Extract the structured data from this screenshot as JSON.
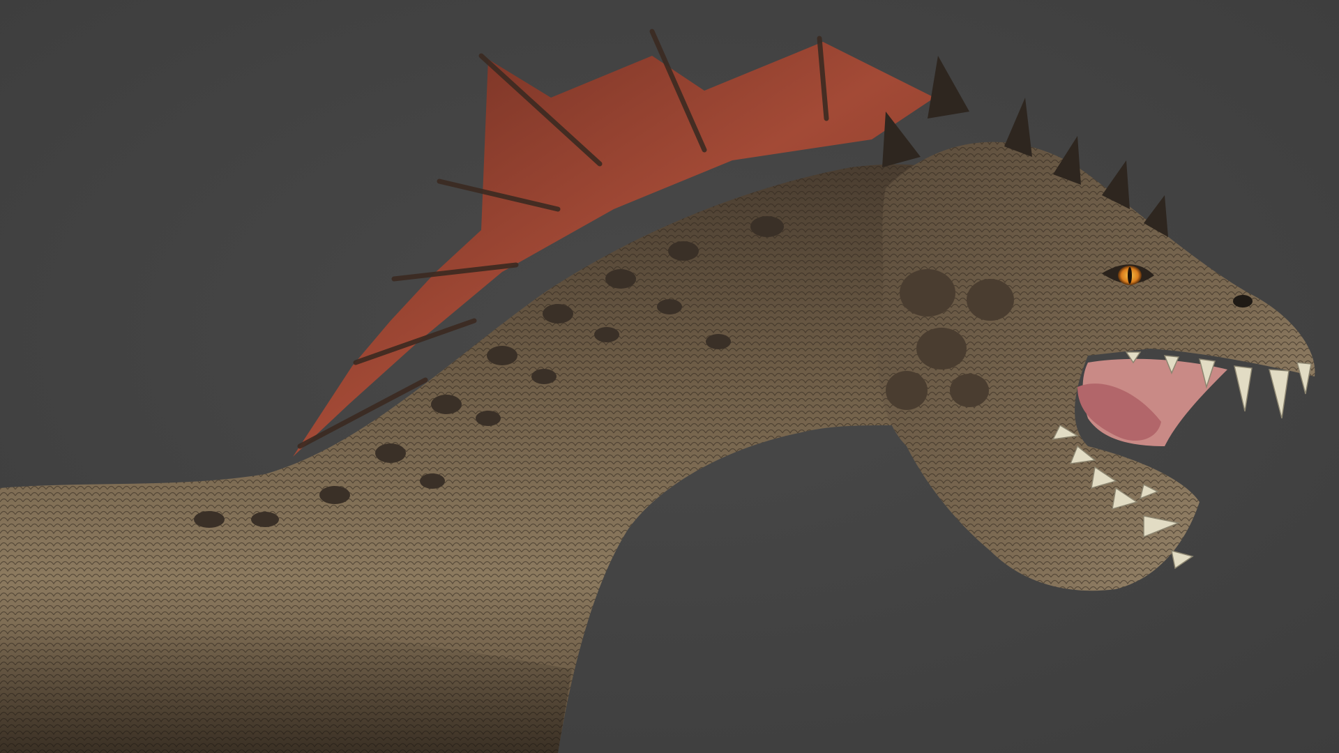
{
  "image": {
    "subject": "creature-render",
    "background_color": "#434343",
    "colors": {
      "scales": "#6e5d47",
      "scales_light": "#9a8668",
      "scales_dark": "#3e3328",
      "crest_membrane": "#8e3c2c",
      "crest_membrane_light": "#b0533d",
      "mouth_interior": "#c98a86",
      "tongue": "#b2666a",
      "teeth": "#e2dcc4",
      "eye_iris": "#e0962a"
    }
  }
}
